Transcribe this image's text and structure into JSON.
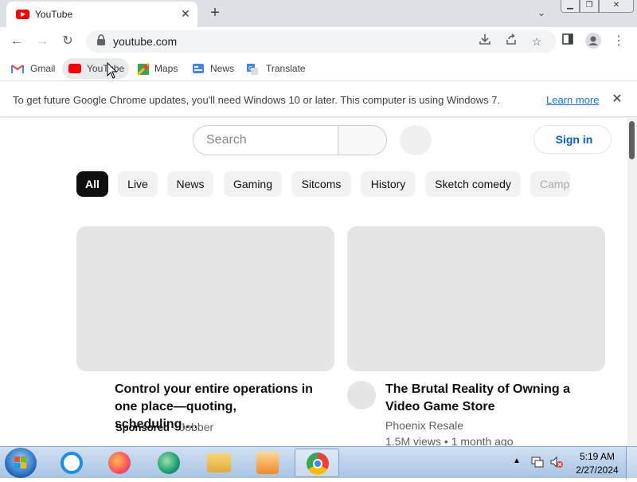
{
  "tab": {
    "title": "YouTube",
    "close_glyph": "✕",
    "new_tab_glyph": "+"
  },
  "window_controls": {
    "minimize": "▁",
    "maximize": "❐",
    "close": "✕"
  },
  "toolbar": {
    "back": "←",
    "forward": "→",
    "reload": "↻",
    "url": "youtube.com",
    "icons": [
      "download-icon",
      "share-icon",
      "star-icon",
      "side-panel-icon",
      "profile-icon",
      "menu-icon"
    ]
  },
  "bookmarks": [
    {
      "label": "Gmail",
      "icon": "gmail-icon"
    },
    {
      "label": "YouTube",
      "icon": "youtube-icon"
    },
    {
      "label": "Maps",
      "icon": "maps-icon"
    },
    {
      "label": "News",
      "icon": "news-icon"
    },
    {
      "label": "Translate",
      "icon": "translate-icon"
    }
  ],
  "infobar": {
    "message": "To get future Google Chrome updates, you'll need Windows 10 or later. This computer is using Windows 7.",
    "link": "Learn more",
    "close_glyph": "✕"
  },
  "youtube": {
    "search_placeholder": "Search",
    "signin": "Sign in",
    "chips": [
      "All",
      "Live",
      "News",
      "Gaming",
      "Sitcoms",
      "History",
      "Sketch comedy",
      "Camp"
    ],
    "videos": [
      {
        "title": "Control your entire operations in one place—quoting, scheduling,…",
        "sponsored": "Sponsored",
        "separator": "·",
        "channel": "Jobber"
      },
      {
        "title": "The Brutal Reality of Owning a Video Game Store",
        "channel": "Phoenix Resale",
        "stats": "1.5M views • 1 month ago"
      }
    ]
  },
  "taskbar": {
    "apps": [
      "internet-explorer-icon",
      "firefox-icon",
      "edge-icon",
      "file-explorer-icon",
      "media-player-icon",
      "chrome-icon"
    ],
    "time": "5:19 AM",
    "date": "2/27/2024"
  },
  "colors": {
    "accent_link": "#1a73e8",
    "youtube_red": "#ff0000",
    "signin_blue": "#065fd4"
  }
}
